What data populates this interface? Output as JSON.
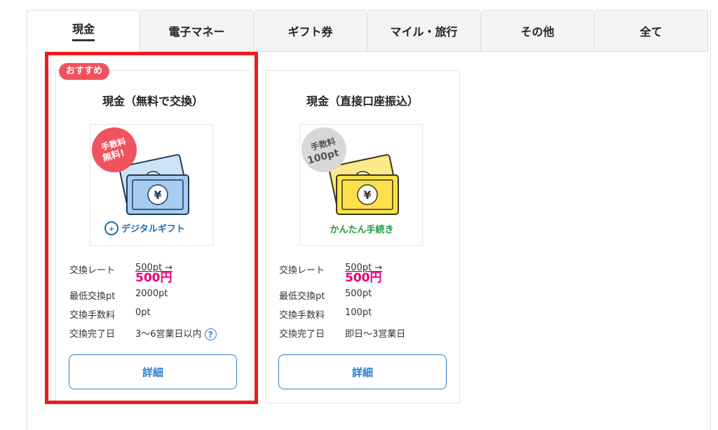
{
  "tabs": [
    {
      "label": "現金",
      "active": true
    },
    {
      "label": "電子マネー",
      "active": false
    },
    {
      "label": "ギフト券",
      "active": false
    },
    {
      "label": "マイル・旅行",
      "active": false
    },
    {
      "label": "その他",
      "active": false
    },
    {
      "label": "全て",
      "active": false
    }
  ],
  "cards": [
    {
      "badge": "おすすめ",
      "title": "現金（無料で交換）",
      "thumb": {
        "fee_top": "手数料",
        "fee_bottom": "無料!",
        "currency": "¥",
        "caption": "デジタルギフト"
      },
      "rows": {
        "rate_label": "交換レート",
        "rate_from": "500pt →",
        "rate_to": "500円",
        "min_label": "最低交換pt",
        "min_value": "2000pt",
        "fee_label": "交換手数料",
        "fee_value": "0pt",
        "date_label": "交換完了日",
        "date_value": "3〜6営業日以内"
      },
      "help_icon": "?",
      "button": "詳細"
    },
    {
      "title": "現金（直接口座振込）",
      "thumb": {
        "fee_top": "手数料",
        "fee_bottom": "100pt",
        "currency": "¥",
        "caption": "かんたん手続き"
      },
      "rows": {
        "rate_label": "交換レート",
        "rate_from": "500pt →",
        "rate_to": "500円",
        "min_label": "最低交換pt",
        "min_value": "500pt",
        "fee_label": "交換手数料",
        "fee_value": "100pt",
        "date_label": "交換完了日",
        "date_value": "即日〜3営業日"
      },
      "button": "詳細"
    }
  ],
  "colors": {
    "highlight": "#ee1c1c",
    "badge": "#f0525e",
    "rate_to": "#e6007e",
    "button_border": "#2f7dd1",
    "caption_green": "#1f9a3a"
  }
}
